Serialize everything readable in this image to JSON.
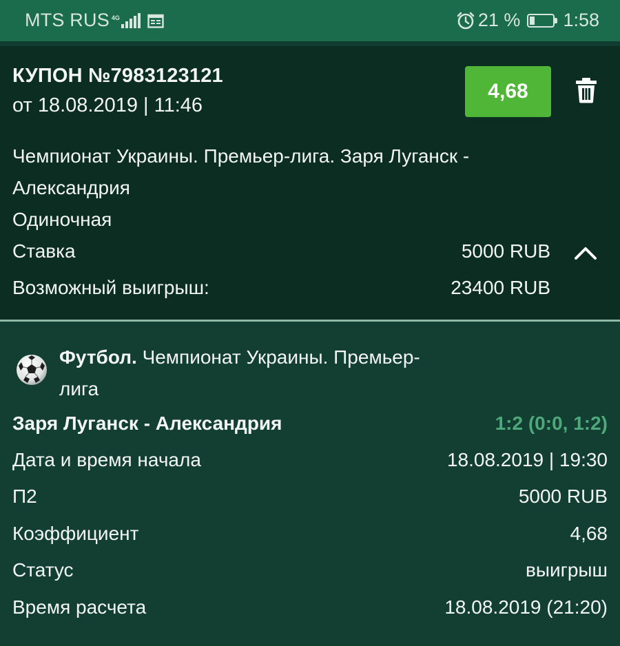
{
  "status_bar": {
    "carrier": "MTS RUS",
    "network": "4G",
    "battery": "21 %",
    "battery_level": 0.21,
    "time": "1:58"
  },
  "coupon": {
    "title": "КУПОН №7983123121",
    "date": "от 18.08.2019 | 11:46",
    "odds": "4,68",
    "event_line1": "Чемпионат Украины. Премьер-лига. Заря Луганск -",
    "event_line2": "Александрия",
    "bet_type": "Одиночная",
    "stake_label": "Ставка",
    "stake_value": "5000 RUB",
    "payout_label": "Возможный выигрыш:",
    "payout_value": "23400 RUB"
  },
  "bet": {
    "sport": "Футбол.",
    "league_line1": " Чемпионат Украины. Премьер-",
    "league_line2": "лига",
    "match": "Заря Луганск - Александрия",
    "score": "1:2 (0:0, 1:2)",
    "rows": [
      {
        "label": "Дата и время начала",
        "value": "18.08.2019 | 19:30"
      },
      {
        "label": "П2",
        "value": "5000 RUB"
      },
      {
        "label": "Коэффициент",
        "value": "4,68"
      },
      {
        "label": "Статус",
        "value": "выигрыш"
      },
      {
        "label": "Время расчета",
        "value": "18.08.2019 (21:20)"
      }
    ]
  },
  "icons": {
    "signal": "signal-icon",
    "calendar": "calendar-icon",
    "alarm": "alarm-icon",
    "battery": "battery-icon",
    "trash": "trash-icon",
    "collapse": "chevron-up-icon",
    "sport": "soccer-ball-icon"
  },
  "colors": {
    "status_bar": "#1b6c4c",
    "coupon_bg": "#0b2d22",
    "details_bg": "#123f31",
    "odds_badge": "#4fb638",
    "score": "#4fa77c"
  }
}
